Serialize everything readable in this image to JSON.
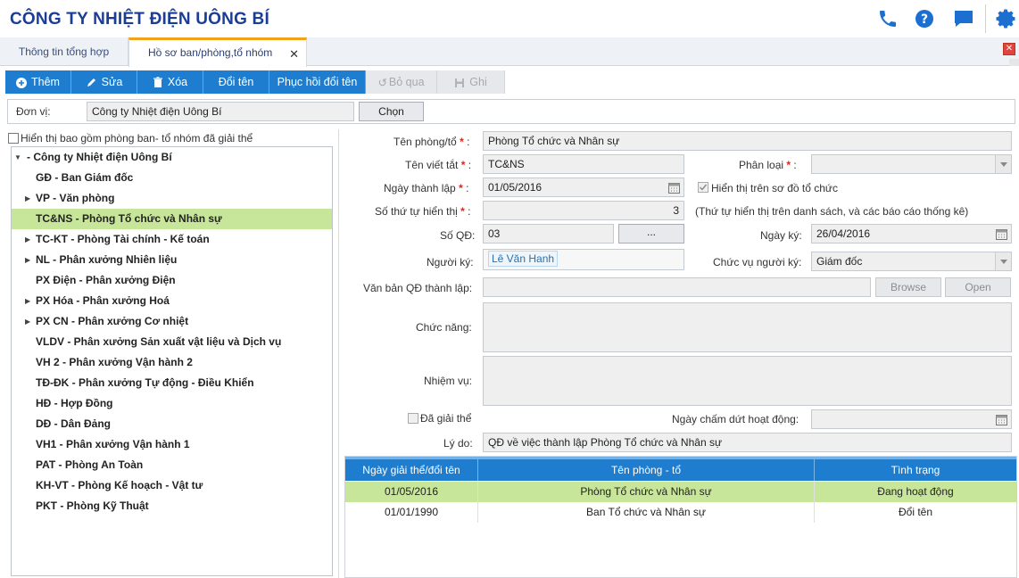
{
  "header": {
    "title": "CÔNG TY NHIỆT ĐIỆN UÔNG BÍ",
    "accent": "#1b6fd0"
  },
  "tabs": [
    {
      "label": "Thông tin tổng hợp"
    },
    {
      "label": "Hồ sơ ban/phòng,tổ nhóm"
    }
  ],
  "toolbar": {
    "add": "Thêm",
    "edit": "Sửa",
    "delete": "Xóa",
    "rename": "Đổi tên",
    "restore_rename": "Phục hồi đổi tên",
    "skip": "Bỏ qua",
    "save": "Ghi"
  },
  "unit": {
    "label": "Đơn vị:",
    "value": "Công ty Nhiệt điện Uông Bí",
    "choose": "Chọn"
  },
  "show_dissolved": {
    "label": "Hiển thị bao gồm phòng ban- tổ nhóm đã giải thể",
    "checked": false
  },
  "tree": {
    "root": "- Công ty Nhiệt điện Uông Bí",
    "items": [
      {
        "label": "GĐ - Ban Giám đốc",
        "expandable": false
      },
      {
        "label": "VP - Văn phòng",
        "expandable": true
      },
      {
        "label": "TC&NS - Phòng Tổ chức và Nhân sự",
        "expandable": false,
        "selected": true
      },
      {
        "label": "TC-KT - Phòng Tài chính - Kế toán",
        "expandable": true
      },
      {
        "label": "NL - Phân xưởng Nhiên liệu",
        "expandable": true
      },
      {
        "label": "PX Điện - Phân xưởng Điện",
        "expandable": false
      },
      {
        "label": "PX Hóa - Phân xưởng Hoá",
        "expandable": true
      },
      {
        "label": "PX CN - Phân xưởng Cơ nhiệt",
        "expandable": true
      },
      {
        "label": "VLDV - Phân xưởng Sản xuất vật liệu và Dịch vụ",
        "expandable": false
      },
      {
        "label": "VH 2 - Phân xưởng Vận hành 2",
        "expandable": false
      },
      {
        "label": "TĐ-ĐK - Phân xưởng Tự động - Điều Khiển",
        "expandable": false
      },
      {
        "label": "HĐ - Hợp Đồng",
        "expandable": false
      },
      {
        "label": "DĐ - Dân Đảng",
        "expandable": false
      },
      {
        "label": "VH1 - Phân xưởng Vận hành 1",
        "expandable": false
      },
      {
        "label": "PAT - Phòng An Toàn",
        "expandable": false
      },
      {
        "label": "KH-VT - Phòng Kế hoạch - Vật tư",
        "expandable": false
      },
      {
        "label": "PKT - Phòng Kỹ Thuật",
        "expandable": false
      }
    ]
  },
  "form": {
    "dept_name_label": "Tên phòng/tổ",
    "dept_name": "Phòng Tổ chức và Nhân sự",
    "short_name_label": "Tên viết tắt",
    "short_name": "TC&NS",
    "category_label": "Phân loại",
    "category": "",
    "founded_label": "Ngày thành lập",
    "founded": "01/05/2016",
    "show_on_chart_label": "Hiển thị trên sơ đồ tổ chức",
    "show_on_chart": true,
    "order_label": "Số thứ tự hiển thị",
    "order": "3",
    "order_note": "(Thứ tự hiển thị trên danh sách, và các báo cáo thống kê)",
    "decision_no_label": "Số QĐ:",
    "decision_no": "03",
    "decision_btn": "...",
    "sign_date_label": "Ngày ký:",
    "sign_date": "26/04/2016",
    "signer_label": "Người ký:",
    "signer": "Lê Văn Hanh",
    "signer_title_label": "Chức vụ người ký:",
    "signer_title": "Giám đốc",
    "doc_label": "Văn bản QĐ thành lập:",
    "doc": "",
    "browse": "Browse",
    "open": "Open",
    "function_label": "Chức năng:",
    "function": "",
    "duty_label": "Nhiệm vụ:",
    "duty": "",
    "dissolved_label": "Đã giải thể",
    "dissolved": false,
    "end_date_label": "Ngày chấm dứt hoạt động:",
    "end_date": "",
    "reason_label": "Lý do:",
    "reason": "QĐ về việc thành lập Phòng Tổ chức và Nhân sự"
  },
  "history": {
    "columns": [
      "Ngày giải thể/đổi tên",
      "Tên phòng - tổ",
      "Tình trạng"
    ],
    "rows": [
      [
        "01/05/2016",
        "Phòng Tổ chức và Nhân sự",
        "Đang hoạt động"
      ],
      [
        "01/01/1990",
        "Ban Tổ chức và Nhân sự",
        "Đổi tên"
      ]
    ]
  }
}
